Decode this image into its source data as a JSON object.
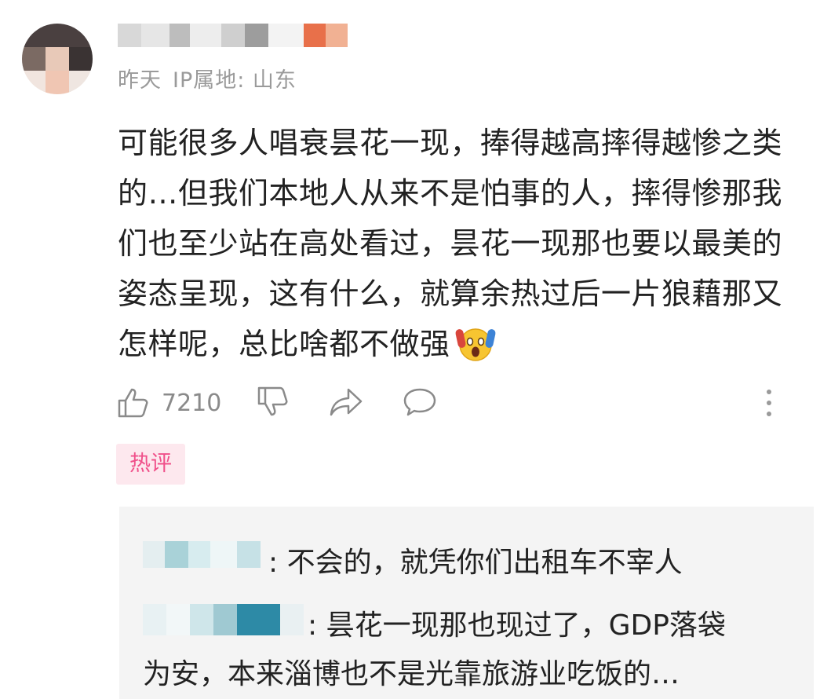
{
  "comment": {
    "time": "昨天",
    "ip_location": "IP属地: 山东",
    "content": "可能很多人唱衰昙花一现，捧得越高摔得越惨之类的…但我们本地人从来不是怕事的人，摔得惨那我们也至少站在高处看过，昙花一现那也要以最美的姿态呈现，这有什么，就算余热过后一片狼藉那又怎样呢，总比啥都不做强",
    "emoji": "scream-emoji",
    "like_count": "7210"
  },
  "actions": {
    "like_icon": "thumbs-up-icon",
    "dislike_icon": "thumbs-down-icon",
    "share_icon": "share-icon",
    "reply_icon": "chat-bubble-icon",
    "more_icon": "more-vertical-icon"
  },
  "badge": {
    "label": "热评"
  },
  "replies": [
    {
      "text": ": 不会的，就凭你们出租车不宰人"
    },
    {
      "text_line1": ": 昙花一现那也现过了，GDP落袋",
      "text_line2": "为安，本来淄博也不是光靠旅游业吃饭的…"
    }
  ],
  "colors": {
    "meta_gray": "#9a9a9a",
    "hot_badge_bg": "#fde8ee",
    "hot_badge_text": "#f0508a",
    "reply_bg": "#f4f4f4"
  }
}
